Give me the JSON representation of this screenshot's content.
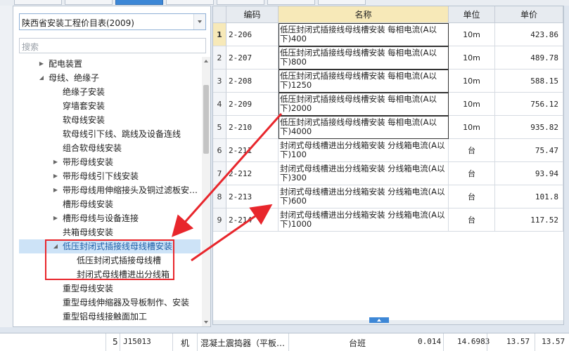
{
  "tabs": [
    {
      "label": "",
      "active": false
    },
    {
      "label": "",
      "active": false
    },
    {
      "label": "",
      "active": true
    },
    {
      "label": "",
      "active": false
    },
    {
      "label": "",
      "active": false
    },
    {
      "label": "",
      "active": false
    },
    {
      "label": "",
      "active": false
    }
  ],
  "combo": {
    "value": "陕西省安装工程价目表(2009)"
  },
  "search": {
    "placeholder": "搜索"
  },
  "tree": [
    {
      "label": "配电装置",
      "level": 2,
      "toggle": "▶"
    },
    {
      "label": "母线、绝缘子",
      "level": 2,
      "toggle": "◢"
    },
    {
      "label": "绝缘子安装",
      "level": 3,
      "toggle": ""
    },
    {
      "label": "穿墙套安装",
      "level": 3,
      "toggle": ""
    },
    {
      "label": "软母线安装",
      "level": 3,
      "toggle": ""
    },
    {
      "label": "软母线引下线、跳线及设备连线",
      "level": 3,
      "toggle": ""
    },
    {
      "label": "组合软母线安装",
      "level": 3,
      "toggle": ""
    },
    {
      "label": "带形母线安装",
      "level": 3,
      "toggle": "▶"
    },
    {
      "label": "带形母线引下线安装",
      "level": 3,
      "toggle": "▶"
    },
    {
      "label": "带形母线用伸缩接头及铜过滤板安…",
      "level": 3,
      "toggle": "▶"
    },
    {
      "label": "槽形母线安装",
      "level": 3,
      "toggle": ""
    },
    {
      "label": "槽形母线与设备连接",
      "level": 3,
      "toggle": "▶"
    },
    {
      "label": "共箱母线安装",
      "level": 3,
      "toggle": ""
    },
    {
      "label": "低压封闭式插接线母线槽安装",
      "level": 3,
      "toggle": "◢",
      "selected": true
    },
    {
      "label": "低压封闭式插接母线槽",
      "level": 4,
      "toggle": ""
    },
    {
      "label": "封闭式母线槽进出分线箱",
      "level": 4,
      "toggle": ""
    },
    {
      "label": "重型母线安装",
      "level": 3,
      "toggle": ""
    },
    {
      "label": "重型母线伸缩器及导板制作、安装",
      "level": 3,
      "toggle": ""
    },
    {
      "label": "重型铝母线接触面加工",
      "level": 3,
      "toggle": ""
    },
    {
      "label": "",
      "level": 2,
      "toggle": ""
    }
  ],
  "grid": {
    "headers": {
      "code": "编码",
      "name": "名称",
      "unit": "单位",
      "price": "单价"
    },
    "rows": [
      {
        "n": "1",
        "code": "2-206",
        "name": "低压封闭式插接线母线槽安装 每相电流(A以下)400",
        "unit": "10m",
        "price": "423.86"
      },
      {
        "n": "2",
        "code": "2-207",
        "name": "低压封闭式插接线母线槽安装 每相电流(A以下)800",
        "unit": "10m",
        "price": "489.78"
      },
      {
        "n": "3",
        "code": "2-208",
        "name": "低压封闭式插接线母线槽安装 每相电流(A以下)1250",
        "unit": "10m",
        "price": "588.15"
      },
      {
        "n": "4",
        "code": "2-209",
        "name": "低压封闭式插接线母线槽安装 每相电流(A以下)2000",
        "unit": "10m",
        "price": "756.12"
      },
      {
        "n": "5",
        "code": "2-210",
        "name": "低压封闭式插接线母线槽安装 每相电流(A以下)4000",
        "unit": "10m",
        "price": "935.82"
      },
      {
        "n": "6",
        "code": "2-211",
        "name": "封闭式母线槽进出分线箱安装 分线箱电流(A以下)100",
        "unit": "台",
        "price": "75.47"
      },
      {
        "n": "7",
        "code": "2-212",
        "name": "封闭式母线槽进出分线箱安装 分线箱电流(A以下)300",
        "unit": "台",
        "price": "93.94"
      },
      {
        "n": "8",
        "code": "2-213",
        "name": "封闭式母线槽进出分线箱安装 分线箱电流(A以下)600",
        "unit": "台",
        "price": "101.8"
      },
      {
        "n": "9",
        "code": "2-214",
        "name": "封闭式母线槽进出分线箱安装 分线箱电流(A以下)1000",
        "unit": "台",
        "price": "117.52"
      }
    ]
  },
  "bottom": {
    "num": "5",
    "code": "J15013",
    "type": "机",
    "name": "混凝土震捣器（平板…",
    "unit": "台班",
    "qty": "0.014",
    "price": "14.6983",
    "price2": "13.57",
    "total": "13.57"
  },
  "colors": {
    "accent": "#3d87d6",
    "annotation": "#e8262c",
    "header_name": "#f7e9b8"
  }
}
